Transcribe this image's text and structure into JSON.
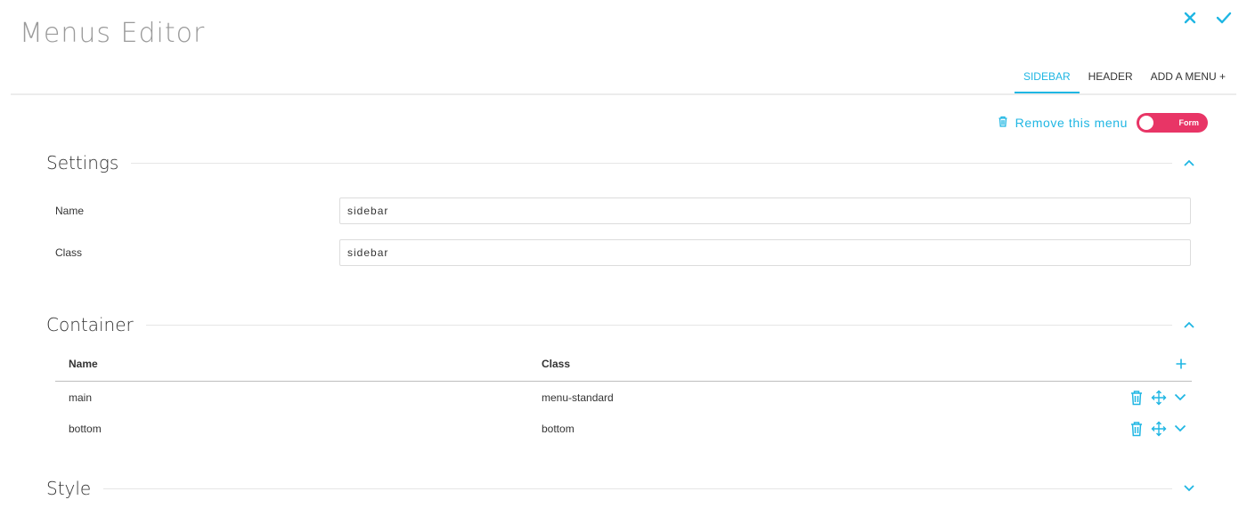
{
  "app": {
    "title": "Menus Editor"
  },
  "header_actions": {
    "close_icon": "close-icon",
    "confirm_icon": "check-icon"
  },
  "tabs": [
    {
      "label": "SIDEBAR",
      "active": true
    },
    {
      "label": "HEADER",
      "active": false
    },
    {
      "label": "ADD A MENU +",
      "active": false
    }
  ],
  "menu_actions": {
    "remove_label": "Remove this menu",
    "toggle_label": "Form",
    "toggle_on": true
  },
  "settings": {
    "title": "Settings",
    "fields": [
      {
        "label": "Name",
        "value": "sidebar"
      },
      {
        "label": "Class",
        "value": "sidebar"
      }
    ]
  },
  "container": {
    "title": "Container",
    "columns": {
      "name": "Name",
      "class": "Class"
    },
    "rows": [
      {
        "name": "main",
        "class": "menu-standard"
      },
      {
        "name": "bottom",
        "class": "bottom"
      }
    ]
  },
  "style": {
    "title": "Style"
  },
  "colors": {
    "accent": "#1fb6e3",
    "toggle": "#e83566",
    "title": "#9a9a9a"
  }
}
